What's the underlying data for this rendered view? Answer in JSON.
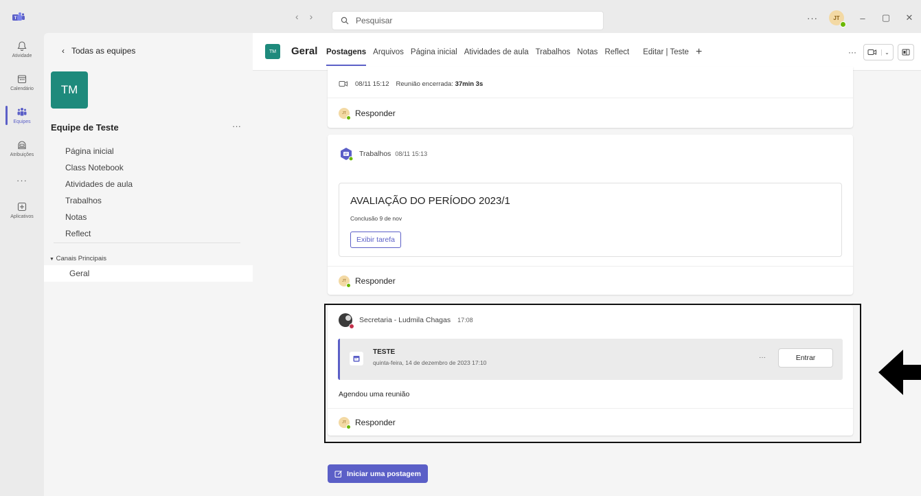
{
  "titlebar": {
    "back_icon": "chevron-left-icon",
    "forward_icon": "chevron-right-icon",
    "search_placeholder": "Pesquisar",
    "more": "···",
    "user_initials": "JT",
    "minimize": "–",
    "restore": "▢",
    "close": "✕"
  },
  "rail": [
    {
      "label": "Atividade",
      "icon": "bell-icon"
    },
    {
      "label": "Calendário",
      "icon": "calendar-icon"
    },
    {
      "label": "Equipes",
      "icon": "teams-icon",
      "active": true
    },
    {
      "label": "Atribuições",
      "icon": "assignments-icon"
    },
    {
      "label": "···",
      "icon": "more-icon"
    },
    {
      "label": "Aplicativos",
      "icon": "apps-plus-icon"
    }
  ],
  "sidebar": {
    "back_label": "Todas as equipes",
    "team_initials": "TM",
    "team_name": "Equipe de Teste",
    "team_more": "···",
    "links": [
      "Página inicial",
      "Class Notebook",
      "Atividades de aula",
      "Trabalhos",
      "Notas",
      "Reflect"
    ],
    "channels_header": "Canais Principais",
    "channel": "Geral"
  },
  "header": {
    "channel_initials": "TM",
    "channel_name": "Geral",
    "tabs": [
      "Postagens",
      "Arquivos",
      "Página inicial",
      "Atividades de aula",
      "Trabalhos",
      "Notas",
      "Reflect"
    ],
    "edit_tab": "Editar | Teste",
    "add_tab": "+",
    "more": "···"
  },
  "feed": {
    "meeting_ended": {
      "datetime": "08/11 15:12",
      "text": "Reunião encerrada:",
      "duration": "37min 3s"
    },
    "reply_label": "Responder",
    "assignment_post": {
      "author": "Trabalhos",
      "time": "08/11 15:13",
      "title": "AVALIAÇÃO DO PERÍODO 2023/1",
      "due": "Conclusão 9 de nov",
      "button": "Exibir tarefa"
    },
    "meeting_post": {
      "author": "Secretaria - Ludmila Chagas",
      "time": "17:08",
      "meeting_title": "TESTE",
      "meeting_date": "quinta-feira, 14 de dezembro de 2023 17:10",
      "more": "···",
      "join": "Entrar",
      "body": "Agendou uma reunião"
    },
    "new_post": "Iniciar uma postagem"
  },
  "colors": {
    "accent": "#5b5fc7",
    "team_tile": "#1e8a7c",
    "presence_available": "#6bb700",
    "presence_busy": "#c4314b"
  }
}
